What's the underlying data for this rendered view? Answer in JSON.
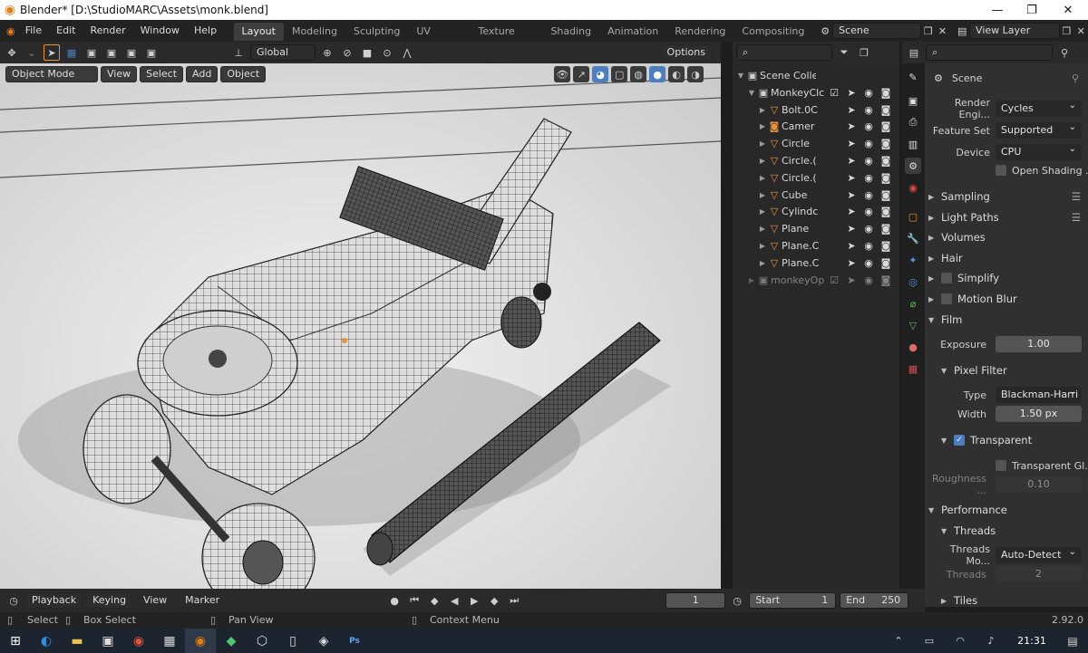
{
  "window": {
    "title": "Blender* [D:\\StudioMARC\\Assets\\monk.blend]",
    "minimize": "—",
    "maximize": "❐",
    "close": "✕"
  },
  "menu": {
    "items": [
      "File",
      "Edit",
      "Render",
      "Window",
      "Help"
    ]
  },
  "workspaces": [
    "Layout",
    "Modeling",
    "Sculpting",
    "UV Editing",
    "Texture Paint",
    "Shading",
    "Animation",
    "Rendering",
    "Compositing"
  ],
  "active_workspace": "Layout",
  "scene_field": "Scene",
  "view_layer_field": "View Layer",
  "viewport": {
    "transform_orientation": "Global",
    "options_label": "Options",
    "mode": "Object Mode",
    "menus": [
      "View",
      "Select",
      "Add",
      "Object"
    ]
  },
  "outliner": {
    "search_placeholder": "",
    "rows": [
      {
        "name": "Scene Collectic",
        "icon": "collection-icon",
        "depth": 0
      },
      {
        "name": "MonkeyClc",
        "icon": "collection-icon",
        "depth": 1,
        "checked": true
      },
      {
        "name": "Bolt.0C",
        "icon": "mesh-icon",
        "depth": 2
      },
      {
        "name": "Camer",
        "icon": "camera-icon",
        "depth": 2
      },
      {
        "name": "Circle",
        "icon": "mesh-icon",
        "depth": 2
      },
      {
        "name": "Circle.(",
        "icon": "mesh-icon",
        "depth": 2
      },
      {
        "name": "Circle.(",
        "icon": "mesh-icon",
        "depth": 2
      },
      {
        "name": "Cube",
        "icon": "mesh-icon",
        "depth": 2
      },
      {
        "name": "Cylindc",
        "icon": "mesh-icon",
        "depth": 2
      },
      {
        "name": "Plane",
        "icon": "mesh-icon",
        "depth": 2
      },
      {
        "name": "Plane.C",
        "icon": "mesh-icon",
        "depth": 2
      },
      {
        "name": "Plane.C",
        "icon": "mesh-icon",
        "depth": 2
      },
      {
        "name": "monkeyOp",
        "icon": "collection-icon",
        "depth": 1,
        "checked": true,
        "dimmed": true
      }
    ]
  },
  "properties": {
    "header": "Scene",
    "render_engine_label": "Render Engi...",
    "render_engine": "Cycles",
    "feature_set_label": "Feature Set",
    "feature_set": "Supported",
    "device_label": "Device",
    "device": "CPU",
    "open_shading_label": "Open Shading ...",
    "sections": {
      "sampling": "Sampling",
      "light_paths": "Light Paths",
      "volumes": "Volumes",
      "hair": "Hair",
      "simplify": "Simplify",
      "motion_blur": "Motion Blur",
      "film": "Film",
      "pixel_filter": "Pixel Filter",
      "transparent": "Transparent",
      "performance": "Performance",
      "threads": "Threads",
      "tiles": "Tiles"
    },
    "exposure_label": "Exposure",
    "exposure": "1.00",
    "type_label": "Type",
    "type": "Blackman-Harri",
    "width_label": "Width",
    "width": "1.50 px",
    "transparent_glass_label": "Transparent Gl...",
    "roughness_label": "Roughness ...",
    "roughness": "0.10",
    "threads_mode_label": "Threads Mo...",
    "threads_mode": "Auto-Detect",
    "threads_label": "Threads",
    "threads": "2"
  },
  "timeline": {
    "menus": [
      "Playback",
      "Keying",
      "View",
      "Marker"
    ],
    "current_frame": "1",
    "start_label": "Start",
    "start": "1",
    "end_label": "End",
    "end": "250"
  },
  "statusbar": {
    "select": "Select",
    "box_select": "Box Select",
    "pan_view": "Pan View",
    "context_menu": "Context Menu",
    "version": "2.92.0"
  },
  "taskbar": {
    "time": "21:31"
  },
  "colors": {
    "accent": "#4a7fc1",
    "orange": "#e8923a",
    "bg": "#1d1d1d"
  }
}
